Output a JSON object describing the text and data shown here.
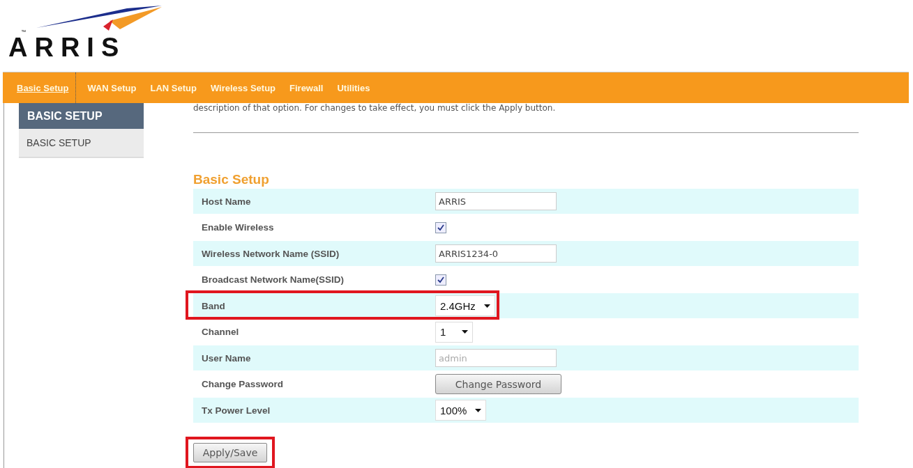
{
  "logo": {
    "text": "ARRIS",
    "mark": "™"
  },
  "nav": [
    {
      "label": "Basic Setup",
      "selected": true
    },
    {
      "label": "WAN Setup",
      "selected": false
    },
    {
      "label": "LAN Setup",
      "selected": false
    },
    {
      "label": "Wireless Setup",
      "selected": false
    },
    {
      "label": "Firewall",
      "selected": false
    },
    {
      "label": "Utilities",
      "selected": false
    }
  ],
  "sidebar": {
    "header": "BASIC SETUP",
    "items": [
      {
        "label": "BASIC SETUP",
        "selected": false
      }
    ]
  },
  "description": "description of that option. For changes to take effect, you must click the Apply button.",
  "section_title": "Basic Setup",
  "rows": [
    {
      "label": "Host Name",
      "kind": "text",
      "value": "ARRIS",
      "highlighted": false
    },
    {
      "label": "Enable Wireless",
      "kind": "checkbox",
      "checked": true,
      "highlighted": false
    },
    {
      "label": "Wireless Network Name (SSID)",
      "kind": "text",
      "value": "ARRIS1234-0",
      "highlighted": false
    },
    {
      "label": "Broadcast Network Name(SSID)",
      "kind": "checkbox",
      "checked": true,
      "highlighted": false
    },
    {
      "label": "Band",
      "kind": "select",
      "value": "2.4GHz",
      "highlighted": true
    },
    {
      "label": "Channel",
      "kind": "select",
      "value": "1",
      "highlighted": false
    },
    {
      "label": "User Name",
      "kind": "text",
      "placeholder": "admin",
      "highlighted": false
    },
    {
      "label": "Change Password",
      "kind": "button",
      "button": "Change Password",
      "highlighted": false
    },
    {
      "label": "Tx Power Level",
      "kind": "select",
      "value": "100%",
      "highlighted": false
    }
  ],
  "apply_button": {
    "label": "Apply/Save",
    "highlighted": true
  }
}
